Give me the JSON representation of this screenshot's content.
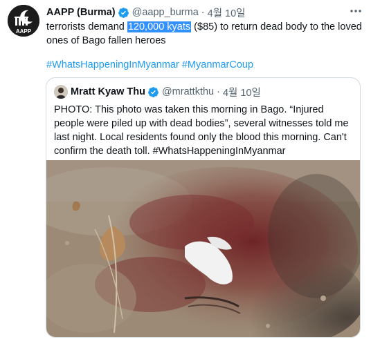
{
  "tweet": {
    "author_name": "AAPP (Burma)",
    "handle": "@aapp_burma",
    "separator": "·",
    "date": "4월 10일",
    "text_before": "terrorists demand ",
    "text_highlight": "120,000 kyats",
    "text_after": " ($85) to return dead body to the loved ones of Bago fallen heroes",
    "hashtags": [
      "#WhatsHappeningInMyanmar",
      "#MyanmarCoup"
    ],
    "avatar_logo_text": "AAPP"
  },
  "quoted_tweet": {
    "author_name": "Mratt Kyaw Thu",
    "handle": "@mrattkthu",
    "separator": "·",
    "date": "4월 10일",
    "text": "PHOTO: This photo was taken this morning in Bago. “Injured people were piled up with dead bodies”, several witnesses told me last night. Local residents found only the blood this morning. Can't confirm the death toll. #WhatsHappeningInMyanmar"
  },
  "colors": {
    "verified": "#1d9bf0",
    "hashtag": "#1d9bf0",
    "selection": "#3390ff",
    "secondary_text": "#536471",
    "border": "#cfd9de"
  },
  "icons": {
    "verified": "verified-badge-icon",
    "more": "more-options-icon"
  }
}
